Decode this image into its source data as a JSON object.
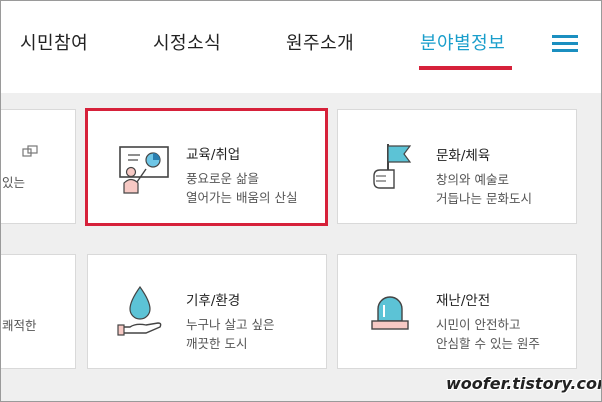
{
  "nav": {
    "items": [
      {
        "label": "시민참여"
      },
      {
        "label": "시정소식"
      },
      {
        "label": "원주소개"
      },
      {
        "label": "분야별정보"
      }
    ],
    "active_index": 3,
    "menu_icon": "hamburger-menu-icon"
  },
  "cards": {
    "partial_top": {
      "desc": "있는"
    },
    "education": {
      "title": "교육/취업",
      "desc_line1": "풍요로운 삶을",
      "desc_line2": "열어가는 배움의 산실",
      "icon": "classroom-teacher-icon"
    },
    "culture": {
      "title": "문화/체육",
      "desc_line1": "창의와 예술로",
      "desc_line2": "거듭나는 문화도시",
      "icon": "flag-hand-icon"
    },
    "partial_bottom": {
      "desc": "쾌적한"
    },
    "climate": {
      "title": "기후/환경",
      "desc_line1": "누구나 살고 싶은",
      "desc_line2": "깨끗한 도시",
      "icon": "water-drop-hand-icon"
    },
    "safety": {
      "title": "재난/안전",
      "desc_line1": "시민이 안전하고",
      "desc_line2": "안심할 수 있는 원주",
      "icon": "siren-icon"
    }
  },
  "colors": {
    "accent_red": "#d6213a",
    "accent_blue": "#1a9ecb"
  },
  "watermark": "woofer.tistory.com"
}
